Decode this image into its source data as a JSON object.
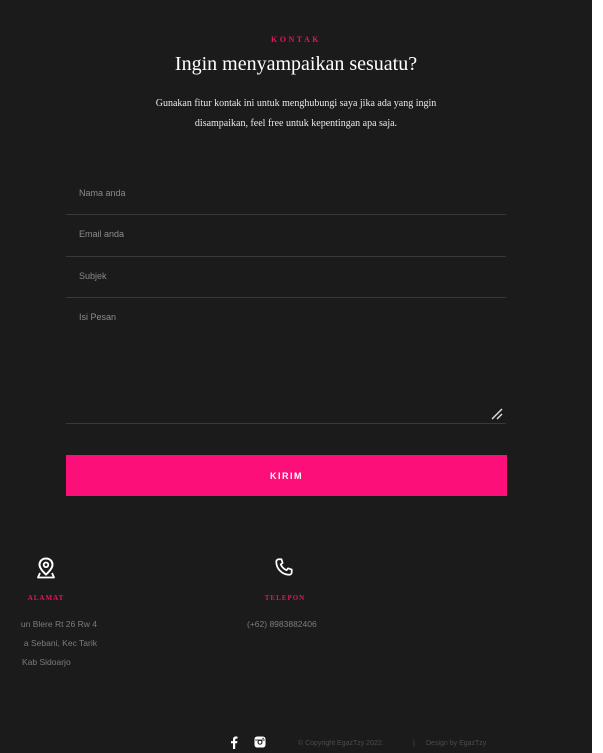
{
  "contact": {
    "kicker": "KONTAK",
    "title": "Ingin menyampaikan sesuatu?",
    "description_line1": "Gunakan fitur kontak ini untuk menghubungi saya jika ada yang ingin",
    "description_line2": "disampaikan, feel free untuk kepentingan apa saja."
  },
  "form": {
    "name_placeholder": "Nama anda",
    "email_placeholder": "Email anda",
    "subject_placeholder": "Subjek",
    "message_placeholder": "Isi Pesan",
    "submit_label": "KIRIM"
  },
  "address": {
    "label": "ALAMAT",
    "lines": [
      "un Blere Rt 26 Rw 4",
      "a Sebani, Kec Tarik",
      "Kab Sidoarjo"
    ],
    "icon": "map-pin-icon"
  },
  "phone": {
    "label": "TELEPON",
    "number": "(+62) 8983882406",
    "icon": "phone-icon"
  },
  "footer": {
    "social_icons": [
      "facebook-icon",
      "instagram-icon"
    ],
    "copyright": "© Copyright EgazTzy 2022.",
    "separator": "|",
    "credit": "Design by EgazTzy"
  },
  "colors": {
    "background": "#1c1b1c",
    "accent": "#fc0f79",
    "label_accent": "#e8125c"
  }
}
